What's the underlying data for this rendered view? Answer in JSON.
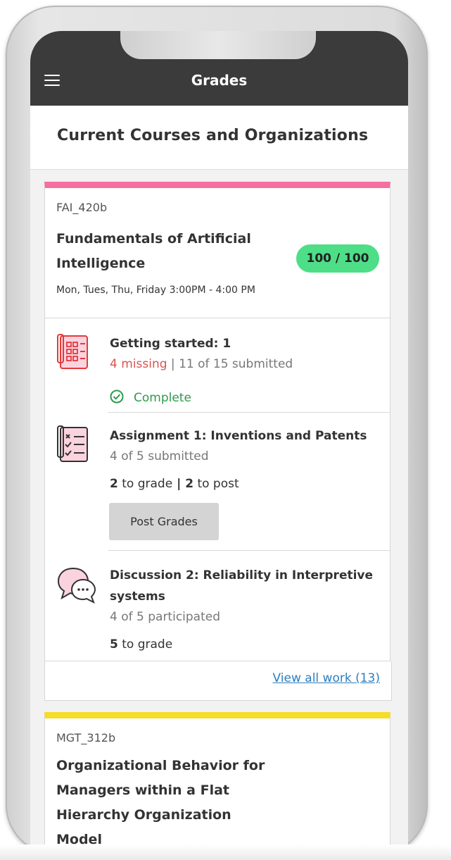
{
  "appbar": {
    "title": "Grades",
    "menu_icon": "hamburger-icon"
  },
  "subheader": {
    "title": "Current Courses and Organizations"
  },
  "courses": [
    {
      "code": "FAI_420b",
      "name_line1": "Fundamentals of Artificial",
      "name_line2": "Intelligence",
      "schedule": "Mon, Tues, Thu, Friday 3:00PM - 4:00 PM",
      "grade": "100 / 100",
      "accent_color": "#f56fa1",
      "items": [
        {
          "icon": "calculator-icon",
          "title": "Getting started: 1",
          "missing": "4 missing",
          "separator": " | ",
          "submitted": "11 of 15 submitted",
          "status": "Complete"
        },
        {
          "icon": "checklist-icon",
          "title": "Assignment 1: Inventions and Patents",
          "submitted": "4 of 5 submitted",
          "to_grade_count": "2",
          "to_grade_label": " to grade",
          "pipe": " | ",
          "to_post_count": "2",
          "to_post_label": " to post",
          "button": "Post Grades"
        },
        {
          "icon": "discussion-icon",
          "title_line1": "Discussion 2: Reliability in Interpretive",
          "title_line2": "systems",
          "participated": "4 of 5 participated",
          "to_grade_count": "5",
          "to_grade_label": " to grade"
        }
      ],
      "view_all": "View all work (13)"
    },
    {
      "code": "MGT_312b",
      "name_line1": "Organizational Behavior for",
      "name_line2": "Managers within a Flat",
      "name_line3": "Hierarchy Organization",
      "name_line4": "Model",
      "accent_color": "#f6dd27"
    }
  ],
  "colors": {
    "appbar": "#3b3b3b",
    "grade_pill": "#4ede87",
    "missing": "#d9534f",
    "complete": "#2e9b4a",
    "link": "#2b7fc0"
  }
}
